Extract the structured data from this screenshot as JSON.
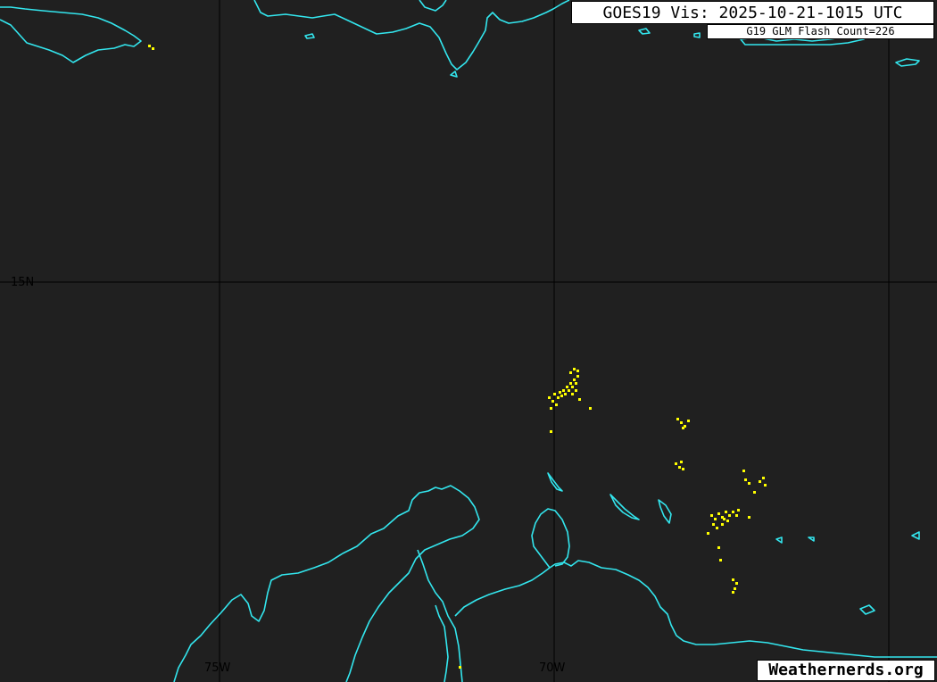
{
  "header": {
    "title": "GOES19 Vis: 2025-10-21-1015 UTC",
    "glm_label": "G19 GLM Flash Count=226"
  },
  "footer": {
    "credit": "Weathernerds.org"
  },
  "grid_labels": {
    "lat_15n": "15N",
    "lon_75w": "75W",
    "lon_70w": "70W"
  },
  "colors": {
    "background": "#202020",
    "coastline": "#33e6ee",
    "gridline": "#000000",
    "lightning": "#ffff00"
  },
  "lightning_clusters": [
    "north-central-cluster",
    "east-upper-cluster",
    "east-middle-cluster",
    "southeast-main-cluster",
    "far-south-cluster",
    "northwest-isolated-cluster"
  ]
}
